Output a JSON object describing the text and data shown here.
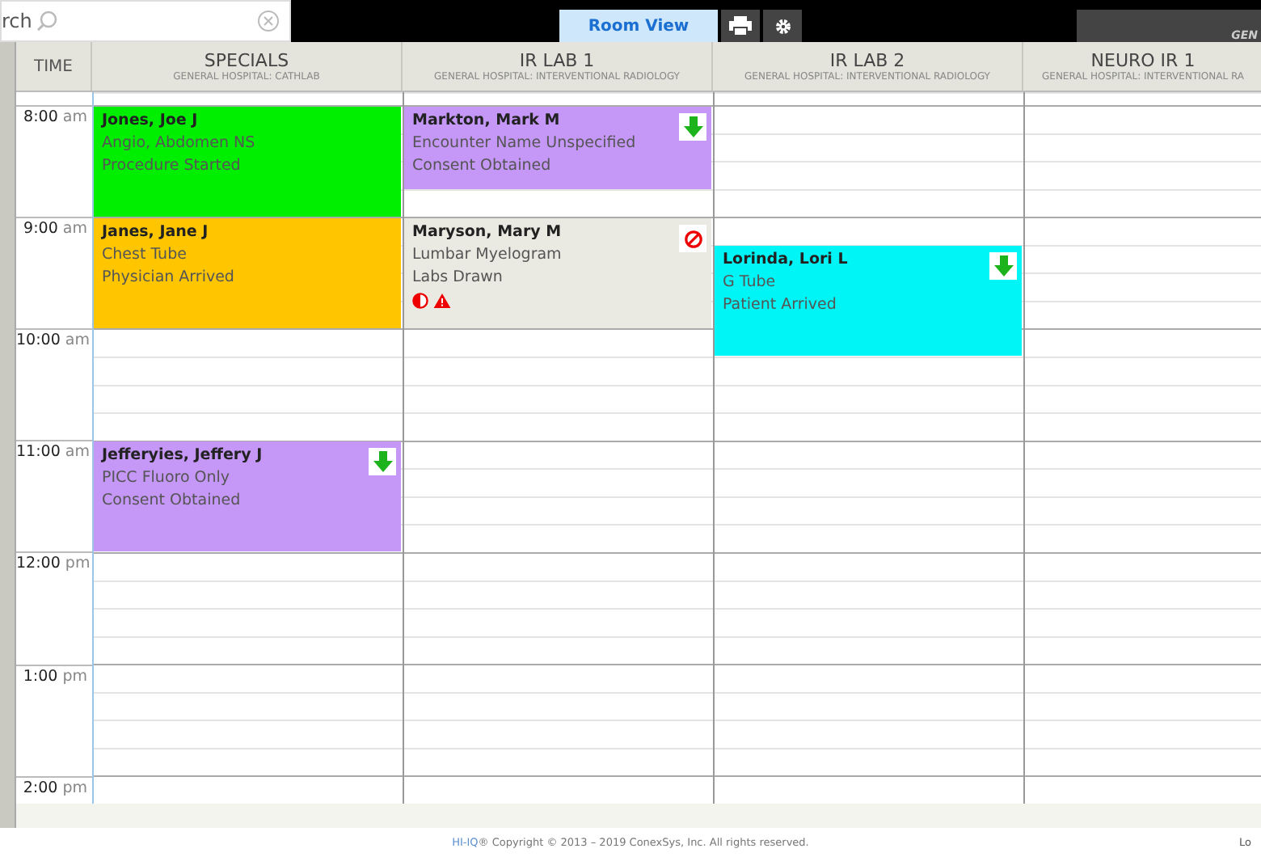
{
  "search": {
    "placeholder": "rch"
  },
  "tabs": [
    {
      "label": "Room View",
      "selected": true
    }
  ],
  "facility_panel": {
    "text": "GEN"
  },
  "time_header": "TIME",
  "rooms": [
    {
      "name": "SPECIALS",
      "location": "GENERAL HOSPITAL: CATHLAB"
    },
    {
      "name": "IR LAB 1",
      "location": "GENERAL HOSPITAL: INTERVENTIONAL RADIOLOGY"
    },
    {
      "name": "IR LAB 2",
      "location": "GENERAL HOSPITAL: INTERVENTIONAL RADIOLOGY"
    },
    {
      "name": "NEURO IR 1",
      "location": "GENERAL HOSPITAL: INTERVENTIONAL RA"
    }
  ],
  "hours": [
    {
      "time": "8:00",
      "meridiem": "am"
    },
    {
      "time": "9:00",
      "meridiem": "am"
    },
    {
      "time": "10:00",
      "meridiem": "am"
    },
    {
      "time": "11:00",
      "meridiem": "am"
    },
    {
      "time": "12:00",
      "meridiem": "pm"
    },
    {
      "time": "1:00",
      "meridiem": "pm"
    },
    {
      "time": "2:00",
      "meridiem": "pm"
    }
  ],
  "appointments": [
    {
      "color": "#00ee00",
      "patient": "Jones, Joe J",
      "procedure": "Angio, Abdomen NS",
      "status": "Procedure Started",
      "transfer": false,
      "blocked": false,
      "contrast_alert": false,
      "warning_alert": false
    },
    {
      "color": "#c597f7",
      "patient": "Markton, Mark M",
      "procedure": "Encounter Name Unspecified",
      "status": "Consent Obtained",
      "transfer": true,
      "blocked": false,
      "contrast_alert": false,
      "warning_alert": false
    },
    {
      "color": "#ffc600",
      "patient": "Janes, Jane J",
      "procedure": "Chest Tube",
      "status": "Physician Arrived",
      "transfer": false,
      "blocked": false,
      "contrast_alert": false,
      "warning_alert": false
    },
    {
      "color": "#ebeae2",
      "patient": "Maryson, Mary M",
      "procedure": "Lumbar Myelogram",
      "status": "Labs Drawn",
      "transfer": false,
      "blocked": true,
      "contrast_alert": true,
      "warning_alert": true
    },
    {
      "color": "#00f6f6",
      "patient": "Lorinda, Lori L",
      "procedure": "G Tube",
      "status": "Patient Arrived",
      "transfer": true,
      "blocked": false,
      "contrast_alert": false,
      "warning_alert": false
    },
    {
      "color": "#c597f7",
      "patient": "Jefferyies, Jeffery J",
      "procedure": "PICC Fluoro Only",
      "status": "Consent Obtained",
      "transfer": true,
      "blocked": false,
      "contrast_alert": false,
      "warning_alert": false
    }
  ],
  "footer": {
    "brand": "HI-IQ",
    "text": "® Copyright © 2013 – 2019 ConexSys, Inc. All rights reserved.",
    "right": "Lo"
  }
}
